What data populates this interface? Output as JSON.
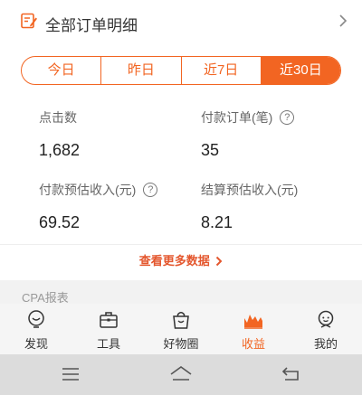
{
  "header": {
    "title": "全部订单明细",
    "icon": "order-detail-icon",
    "accent": "#f26522"
  },
  "date_tabs": [
    {
      "label": "今日",
      "active": false
    },
    {
      "label": "昨日",
      "active": false
    },
    {
      "label": "近7日",
      "active": false
    },
    {
      "label": "近30日",
      "active": true
    }
  ],
  "metrics": {
    "clicks": {
      "label": "点击数",
      "value": "1,682"
    },
    "paid_orders": {
      "label": "付款订单(笔)",
      "value": "35"
    },
    "paid_est_income": {
      "label": "付款预估收入(元)",
      "value": "69.52"
    },
    "settled_est_income": {
      "label": "结算预估收入(元)",
      "value": "8.21"
    }
  },
  "more_link": {
    "label": "查看更多数据"
  },
  "section_title": "CPA报表",
  "tabbar": [
    {
      "label": "发现",
      "icon": "discover-icon",
      "active": false
    },
    {
      "label": "工具",
      "icon": "toolbox-icon",
      "active": false
    },
    {
      "label": "好物圈",
      "icon": "shopping-bag-icon",
      "active": false
    },
    {
      "label": "收益",
      "icon": "earnings-chart-icon",
      "active": true
    },
    {
      "label": "我的",
      "icon": "profile-icon",
      "active": false
    }
  ],
  "system_nav": [
    "menu-icon",
    "home-icon",
    "back-icon"
  ]
}
